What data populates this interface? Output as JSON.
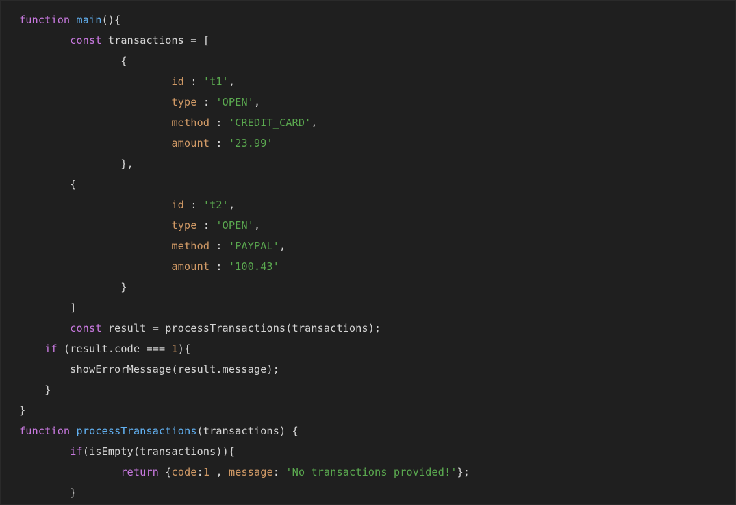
{
  "colors": {
    "background": "#1f1f1f",
    "keyword": "#c678dd",
    "function": "#61afef",
    "property": "#d19a66",
    "string": "#5aa84f",
    "number": "#d19a66",
    "text": "#d4d4d4"
  },
  "code": {
    "lines": [
      {
        "indent": 0,
        "tokens": [
          {
            "t": "kw",
            "v": "function"
          },
          {
            "t": "text",
            "v": " "
          },
          {
            "t": "fn",
            "v": "main"
          },
          {
            "t": "text",
            "v": "(){"
          }
        ]
      },
      {
        "indent": 8,
        "tokens": [
          {
            "t": "kw",
            "v": "const"
          },
          {
            "t": "text",
            "v": " transactions = ["
          }
        ]
      },
      {
        "indent": 16,
        "tokens": [
          {
            "t": "text",
            "v": "{"
          }
        ]
      },
      {
        "indent": 24,
        "tokens": [
          {
            "t": "prop",
            "v": "id"
          },
          {
            "t": "text",
            "v": " : "
          },
          {
            "t": "str",
            "v": "'t1'"
          },
          {
            "t": "text",
            "v": ","
          }
        ]
      },
      {
        "indent": 24,
        "tokens": [
          {
            "t": "prop",
            "v": "type"
          },
          {
            "t": "text",
            "v": " : "
          },
          {
            "t": "str",
            "v": "'OPEN'"
          },
          {
            "t": "text",
            "v": ","
          }
        ]
      },
      {
        "indent": 24,
        "tokens": [
          {
            "t": "prop",
            "v": "method"
          },
          {
            "t": "text",
            "v": " : "
          },
          {
            "t": "str",
            "v": "'CREDIT_CARD'"
          },
          {
            "t": "text",
            "v": ","
          }
        ]
      },
      {
        "indent": 24,
        "tokens": [
          {
            "t": "prop",
            "v": "amount"
          },
          {
            "t": "text",
            "v": " : "
          },
          {
            "t": "str",
            "v": "'23.99'"
          }
        ]
      },
      {
        "indent": 16,
        "tokens": [
          {
            "t": "text",
            "v": "},"
          }
        ]
      },
      {
        "indent": 8,
        "tokens": [
          {
            "t": "text",
            "v": "{"
          }
        ]
      },
      {
        "indent": 24,
        "tokens": [
          {
            "t": "prop",
            "v": "id"
          },
          {
            "t": "text",
            "v": " : "
          },
          {
            "t": "str",
            "v": "'t2'"
          },
          {
            "t": "text",
            "v": ","
          }
        ]
      },
      {
        "indent": 24,
        "tokens": [
          {
            "t": "prop",
            "v": "type"
          },
          {
            "t": "text",
            "v": " : "
          },
          {
            "t": "str",
            "v": "'OPEN'"
          },
          {
            "t": "text",
            "v": ","
          }
        ]
      },
      {
        "indent": 24,
        "tokens": [
          {
            "t": "prop",
            "v": "method"
          },
          {
            "t": "text",
            "v": " : "
          },
          {
            "t": "str",
            "v": "'PAYPAL'"
          },
          {
            "t": "text",
            "v": ","
          }
        ]
      },
      {
        "indent": 24,
        "tokens": [
          {
            "t": "prop",
            "v": "amount"
          },
          {
            "t": "text",
            "v": " : "
          },
          {
            "t": "str",
            "v": "'100.43'"
          }
        ]
      },
      {
        "indent": 16,
        "tokens": [
          {
            "t": "text",
            "v": "}"
          }
        ]
      },
      {
        "indent": 8,
        "tokens": [
          {
            "t": "text",
            "v": "]"
          }
        ]
      },
      {
        "indent": 8,
        "tokens": [
          {
            "t": "kw",
            "v": "const"
          },
          {
            "t": "text",
            "v": " result = processTransactions(transactions);"
          }
        ]
      },
      {
        "indent": 4,
        "tokens": [
          {
            "t": "kw",
            "v": "if"
          },
          {
            "t": "text",
            "v": " (result.code === "
          },
          {
            "t": "num",
            "v": "1"
          },
          {
            "t": "text",
            "v": "){"
          }
        ]
      },
      {
        "indent": 8,
        "tokens": [
          {
            "t": "text",
            "v": "showErrorMessage(result.message);"
          }
        ]
      },
      {
        "indent": 4,
        "tokens": [
          {
            "t": "text",
            "v": "}"
          }
        ]
      },
      {
        "indent": 0,
        "tokens": [
          {
            "t": "text",
            "v": "}"
          }
        ]
      },
      {
        "indent": 0,
        "tokens": [
          {
            "t": "kw",
            "v": "function"
          },
          {
            "t": "text",
            "v": " "
          },
          {
            "t": "fn",
            "v": "processTransactions"
          },
          {
            "t": "text",
            "v": "(transactions) {"
          }
        ]
      },
      {
        "indent": 8,
        "tokens": [
          {
            "t": "kw",
            "v": "if"
          },
          {
            "t": "text",
            "v": "(isEmpty(transactions)){"
          }
        ]
      },
      {
        "indent": 16,
        "tokens": [
          {
            "t": "kw",
            "v": "return"
          },
          {
            "t": "text",
            "v": " {"
          },
          {
            "t": "prop",
            "v": "code"
          },
          {
            "t": "text",
            "v": ":"
          },
          {
            "t": "num",
            "v": "1"
          },
          {
            "t": "text",
            "v": " , "
          },
          {
            "t": "prop",
            "v": "message"
          },
          {
            "t": "text",
            "v": ": "
          },
          {
            "t": "str",
            "v": "'No transactions provided!'"
          },
          {
            "t": "text",
            "v": "};"
          }
        ]
      },
      {
        "indent": 8,
        "tokens": [
          {
            "t": "text",
            "v": "}"
          }
        ]
      }
    ]
  }
}
